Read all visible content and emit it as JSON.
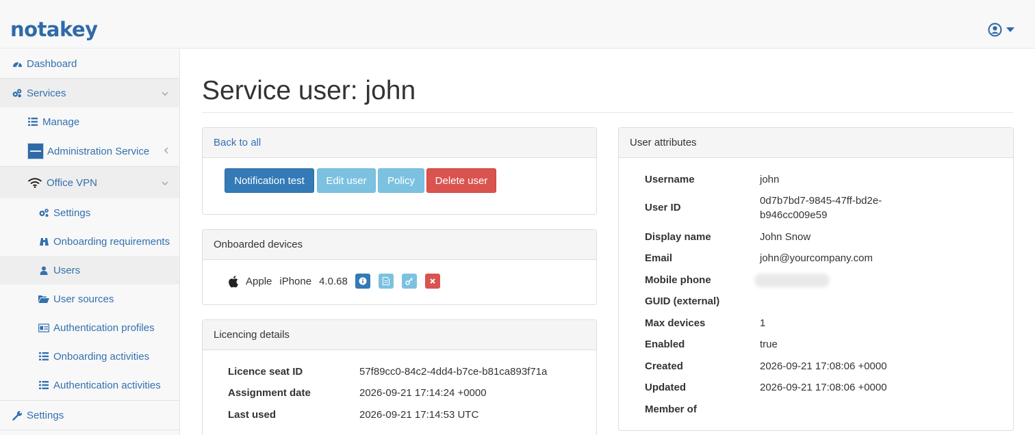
{
  "brand": {
    "logo_text": "notakey",
    "accent": "#2f6aa8"
  },
  "header": {
    "user_menu_icon": "user-circle-icon"
  },
  "sidebar": {
    "items": [
      {
        "label": "Dashboard",
        "icon": "dashboard-icon"
      },
      {
        "label": "Services",
        "icon": "services-icon"
      },
      {
        "label": "Manage",
        "icon": "list-icon"
      },
      {
        "label": "Administration Service",
        "icon": "service-badge-icon"
      },
      {
        "label": "Office VPN",
        "icon": "wifi-icon"
      },
      {
        "label": "Settings",
        "icon": "gears-icon"
      },
      {
        "label": "Onboarding requirements",
        "icon": "binoculars-icon"
      },
      {
        "label": "Users",
        "icon": "user-icon"
      },
      {
        "label": "User sources",
        "icon": "folder-open-icon"
      },
      {
        "label": "Authentication profiles",
        "icon": "id-card-icon"
      },
      {
        "label": "Onboarding activities",
        "icon": "list-icon"
      },
      {
        "label": "Authentication activities",
        "icon": "list-icon"
      },
      {
        "label": "Settings",
        "icon": "wrench-icon"
      }
    ]
  },
  "main": {
    "title": "Service user: john",
    "back_link": "Back to all",
    "buttons": {
      "notification_test": "Notification test",
      "edit_user": "Edit user",
      "policy": "Policy",
      "delete_user": "Delete user"
    },
    "devices": {
      "title": "Onboarded devices",
      "items": [
        {
          "vendor": "Apple",
          "model": "iPhone",
          "version": "4.0.68"
        }
      ]
    },
    "licencing": {
      "title": "Licencing details",
      "rows": [
        {
          "key": "Licence seat ID",
          "value": "57f89cc0-84c2-4dd4-b7ce-b81ca893f71a"
        },
        {
          "key": "Assignment date",
          "value": "2026-09-21 17:14:24 +0000"
        },
        {
          "key": "Last used",
          "value": "2026-09-21 17:14:53 UTC"
        }
      ]
    },
    "attributes": {
      "title": "User attributes",
      "username_label": "Username",
      "username": "john",
      "userid_label": "User ID",
      "userid_line1": "0d7b7bd7-9845-47ff-bd2e-",
      "userid_line2": "b946cc009e59",
      "display_label": "Display name",
      "display": "John Snow",
      "email_label": "Email",
      "email": "john@yourcompany.com",
      "mobile_label": "Mobile phone",
      "guid_label": "GUID (external)",
      "maxdev_label": "Max devices",
      "maxdev": "1",
      "enabled_label": "Enabled",
      "enabled": "true",
      "created_label": "Created",
      "created": "2026-09-21 17:08:06 +0000",
      "updated_label": "Updated",
      "updated": "2026-09-21 17:08:06 +0000",
      "memberof_label": "Member of"
    }
  }
}
